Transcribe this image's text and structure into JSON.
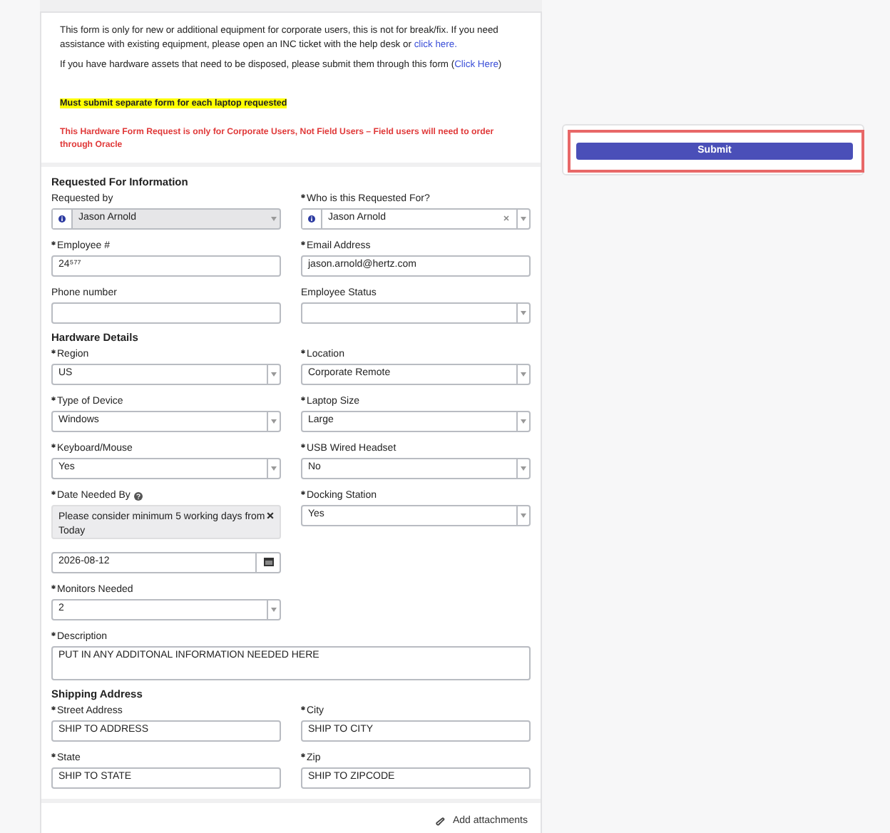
{
  "notice": {
    "paragraphs": [
      {
        "before": "This form is only for new or additional equipment for corporate users, this is not for break/fix. If you need assistance with existing equipment, please open an INC ticket with the help desk or ",
        "link": "click here."
      },
      {
        "before": "If you have hardware assets that need to be disposed, please submit them through this form (",
        "link": "Click Here",
        "after": ")"
      }
    ],
    "highlight": "Must submit separate form for each laptop requested",
    "warning": "This Hardware Form Request is only for Corporate Users, Not Field Users – Field users will need to order through Oracle"
  },
  "sections": [
    {
      "title": "Requested For Information",
      "fields": [
        {
          "kind": "readonly-lookup",
          "label": "Requested by",
          "required": false,
          "value": "Jason Arnold"
        },
        {
          "kind": "lookup",
          "label": "Who is this Requested For?",
          "required": true,
          "value": "Jason Arnold"
        },
        {
          "kind": "text",
          "label": "Employee #",
          "required": true,
          "value": "24⁵⁷⁷"
        },
        {
          "kind": "text",
          "label": "Email Address",
          "required": true,
          "value": "jason.arnold@hertz.com"
        },
        {
          "kind": "text",
          "label": "Phone number",
          "required": false
        },
        {
          "kind": "select",
          "label": "Employee Status",
          "required": false
        }
      ]
    },
    {
      "title": "Hardware Details",
      "fields": [
        {
          "kind": "select",
          "label": "Region",
          "required": true,
          "value": "US"
        },
        {
          "kind": "select",
          "label": "Location",
          "required": true,
          "value": "Corporate Remote"
        },
        {
          "kind": "select",
          "label": "Type of Device",
          "required": true,
          "value": "Windows"
        },
        {
          "kind": "select",
          "label": "Laptop Size",
          "required": true,
          "value": "Large"
        },
        {
          "kind": "select",
          "label": "Keyboard/Mouse",
          "required": true,
          "value": "Yes"
        },
        {
          "kind": "select",
          "label": "USB Wired Headset",
          "required": true,
          "value": "No"
        },
        {
          "kind": "date",
          "label": "Date Needed By",
          "required": true,
          "value": "2026-08-12",
          "message": "Please consider minimum 5 working days from Today"
        },
        {
          "kind": "select",
          "label": "Docking Station",
          "required": true,
          "value": "Yes"
        },
        {
          "kind": "select",
          "label": "Monitors Needed",
          "required": true,
          "value": "2"
        },
        {
          "kind": "textarea",
          "label": "Description",
          "required": true,
          "value": "PUT IN ANY ADDITONAL INFORMATION NEEDED HERE"
        }
      ]
    },
    {
      "title": "Shipping Address",
      "fields": [
        {
          "kind": "text",
          "label": "Street Address",
          "required": true,
          "value": "SHIP TO ADDRESS"
        },
        {
          "kind": "text",
          "label": "City",
          "required": true,
          "value": "SHIP TO CITY"
        },
        {
          "kind": "text",
          "label": "State",
          "required": true,
          "value": "SHIP TO STATE"
        },
        {
          "kind": "text",
          "label": "Zip",
          "required": true,
          "value": "SHIP TO ZIPCODE"
        }
      ]
    }
  ],
  "attachments": {
    "label": "Add attachments"
  },
  "submit": {
    "label": "Submit",
    "highlighted": true
  }
}
